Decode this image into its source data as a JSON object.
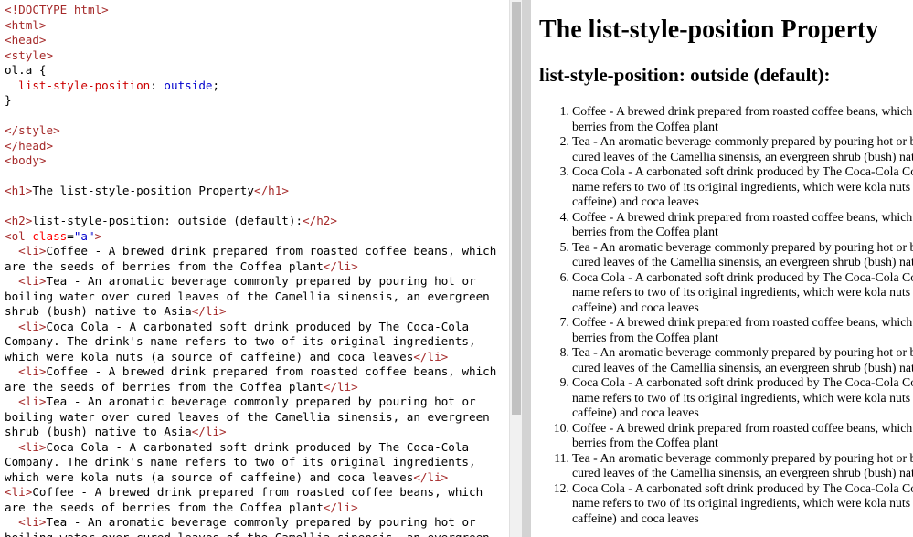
{
  "editor": {
    "lines": [
      [
        {
          "c": "tag",
          "t": "<!DOCTYPE html>"
        }
      ],
      [
        {
          "c": "tag",
          "t": "<html>"
        }
      ],
      [
        {
          "c": "tag",
          "t": "<head>"
        }
      ],
      [
        {
          "c": "tag",
          "t": "<style>"
        }
      ],
      [
        {
          "c": "txt",
          "t": "ol.a {"
        }
      ],
      [
        {
          "c": "txt",
          "t": "  "
        },
        {
          "c": "prop",
          "t": "list-style-position"
        },
        {
          "c": "txt",
          "t": ": "
        },
        {
          "c": "val",
          "t": "outside"
        },
        {
          "c": "txt",
          "t": ";"
        }
      ],
      [
        {
          "c": "txt",
          "t": "}"
        }
      ],
      [
        {
          "c": "txt",
          "t": ""
        }
      ],
      [
        {
          "c": "tag",
          "t": "</style>"
        }
      ],
      [
        {
          "c": "tag",
          "t": "</head>"
        }
      ],
      [
        {
          "c": "tag",
          "t": "<body>"
        }
      ],
      [
        {
          "c": "txt",
          "t": ""
        }
      ],
      [
        {
          "c": "tag",
          "t": "<h1>"
        },
        {
          "c": "txt",
          "t": "The list-style-position Property"
        },
        {
          "c": "tag",
          "t": "</h1>"
        }
      ],
      [
        {
          "c": "txt",
          "t": ""
        }
      ],
      [
        {
          "c": "tag",
          "t": "<h2>"
        },
        {
          "c": "txt",
          "t": "list-style-position: outside (default):"
        },
        {
          "c": "tag",
          "t": "</h2>"
        }
      ],
      [
        {
          "c": "tag",
          "t": "<ol"
        },
        {
          "c": "attr",
          "t": " class"
        },
        {
          "c": "txt",
          "t": "="
        },
        {
          "c": "str",
          "t": "\"a\""
        },
        {
          "c": "tag",
          "t": ">"
        }
      ],
      [
        {
          "c": "txt",
          "t": "  "
        },
        {
          "c": "tag",
          "t": "<li>"
        },
        {
          "c": "txt",
          "t": "Coffee - A brewed drink prepared from roasted coffee beans, which"
        }
      ],
      [
        {
          "c": "txt",
          "t": "are the seeds of berries from the Coffea plant"
        },
        {
          "c": "tag",
          "t": "</li>"
        }
      ],
      [
        {
          "c": "txt",
          "t": "  "
        },
        {
          "c": "tag",
          "t": "<li>"
        },
        {
          "c": "txt",
          "t": "Tea - An aromatic beverage commonly prepared by pouring hot or"
        }
      ],
      [
        {
          "c": "txt",
          "t": "boiling water over cured leaves of the Camellia sinensis, an evergreen"
        }
      ],
      [
        {
          "c": "txt",
          "t": "shrub (bush) native to Asia"
        },
        {
          "c": "tag",
          "t": "</li>"
        }
      ],
      [
        {
          "c": "txt",
          "t": "  "
        },
        {
          "c": "tag",
          "t": "<li>"
        },
        {
          "c": "txt",
          "t": "Coca Cola - A carbonated soft drink produced by The Coca-Cola"
        }
      ],
      [
        {
          "c": "txt",
          "t": "Company. The drink's name refers to two of its original ingredients,"
        }
      ],
      [
        {
          "c": "txt",
          "t": "which were kola nuts (a source of caffeine) and coca leaves"
        },
        {
          "c": "tag",
          "t": "</li>"
        }
      ],
      [
        {
          "c": "txt",
          "t": "  "
        },
        {
          "c": "tag",
          "t": "<li>"
        },
        {
          "c": "txt",
          "t": "Coffee - A brewed drink prepared from roasted coffee beans, which"
        }
      ],
      [
        {
          "c": "txt",
          "t": "are the seeds of berries from the Coffea plant"
        },
        {
          "c": "tag",
          "t": "</li>"
        }
      ],
      [
        {
          "c": "txt",
          "t": "  "
        },
        {
          "c": "tag",
          "t": "<li>"
        },
        {
          "c": "txt",
          "t": "Tea - An aromatic beverage commonly prepared by pouring hot or"
        }
      ],
      [
        {
          "c": "txt",
          "t": "boiling water over cured leaves of the Camellia sinensis, an evergreen"
        }
      ],
      [
        {
          "c": "txt",
          "t": "shrub (bush) native to Asia"
        },
        {
          "c": "tag",
          "t": "</li>"
        }
      ],
      [
        {
          "c": "txt",
          "t": "  "
        },
        {
          "c": "tag",
          "t": "<li>"
        },
        {
          "c": "txt",
          "t": "Coca Cola - A carbonated soft drink produced by The Coca-Cola"
        }
      ],
      [
        {
          "c": "txt",
          "t": "Company. The drink's name refers to two of its original ingredients,"
        }
      ],
      [
        {
          "c": "txt",
          "t": "which were kola nuts (a source of caffeine) and coca leaves"
        },
        {
          "c": "tag",
          "t": "</li>"
        }
      ],
      [
        {
          "c": "tag",
          "t": "<li>"
        },
        {
          "c": "txt",
          "t": "Coffee - A brewed drink prepared from roasted coffee beans, which"
        }
      ],
      [
        {
          "c": "txt",
          "t": "are the seeds of berries from the Coffea plant"
        },
        {
          "c": "tag",
          "t": "</li>"
        }
      ],
      [
        {
          "c": "txt",
          "t": "  "
        },
        {
          "c": "tag",
          "t": "<li>"
        },
        {
          "c": "txt",
          "t": "Tea - An aromatic beverage commonly prepared by pouring hot or"
        }
      ],
      [
        {
          "c": "txt",
          "t": "boiling water over cured leaves of the Camellia sinensis, an evergreen"
        }
      ]
    ]
  },
  "preview": {
    "h1": "The list-style-position Property",
    "h2": "list-style-position: outside (default):",
    "items": [
      {
        "num": "1.",
        "lines": [
          "Coffee - A brewed drink prepared from roasted coffee beans, which are the seeds of",
          "berries from the Coffea plant"
        ]
      },
      {
        "num": "2.",
        "lines": [
          "Tea - An aromatic beverage commonly prepared by pouring hot or boiling water over",
          "cured leaves of the Camellia sinensis, an evergreen shrub (bush) native to Asia"
        ]
      },
      {
        "num": "3.",
        "lines": [
          "Coca Cola - A carbonated soft drink produced by The Coca-Cola Company. The drink's",
          "name refers to two of its original ingredients, which were kola nuts (a source of",
          "caffeine) and coca leaves"
        ]
      },
      {
        "num": "4.",
        "lines": [
          "Coffee - A brewed drink prepared from roasted coffee beans, which are the seeds of",
          "berries from the Coffea plant"
        ]
      },
      {
        "num": "5.",
        "lines": [
          "Tea - An aromatic beverage commonly prepared by pouring hot or boiling water over",
          "cured leaves of the Camellia sinensis, an evergreen shrub (bush) native to Asia"
        ]
      },
      {
        "num": "6.",
        "lines": [
          "Coca Cola - A carbonated soft drink produced by The Coca-Cola Company. The drink's",
          "name refers to two of its original ingredients, which were kola nuts (a source of",
          "caffeine) and coca leaves"
        ]
      },
      {
        "num": "7.",
        "lines": [
          "Coffee - A brewed drink prepared from roasted coffee beans, which are the seeds of",
          "berries from the Coffea plant"
        ]
      },
      {
        "num": "8.",
        "lines": [
          "Tea - An aromatic beverage commonly prepared by pouring hot or boiling water over",
          "cured leaves of the Camellia sinensis, an evergreen shrub (bush) native to Asia"
        ]
      },
      {
        "num": "9.",
        "lines": [
          "Coca Cola - A carbonated soft drink produced by The Coca-Cola Company. The drink's",
          "name refers to two of its original ingredients, which were kola nuts (a source of",
          "caffeine) and coca leaves"
        ]
      },
      {
        "num": "10.",
        "lines": [
          "Coffee - A brewed drink prepared from roasted coffee beans, which are the seeds of",
          "berries from the Coffea plant"
        ]
      },
      {
        "num": "11.",
        "lines": [
          "Tea - An aromatic beverage commonly prepared by pouring hot or boiling water over",
          "cured leaves of the Camellia sinensis, an evergreen shrub (bush) native to Asia"
        ]
      },
      {
        "num": "12.",
        "lines": [
          "Coca Cola - A carbonated soft drink produced by The Coca-Cola Company. The drink's",
          "name refers to two of its original ingredients, which were kola nuts (a source of",
          "caffeine) and coca leaves"
        ]
      }
    ]
  }
}
